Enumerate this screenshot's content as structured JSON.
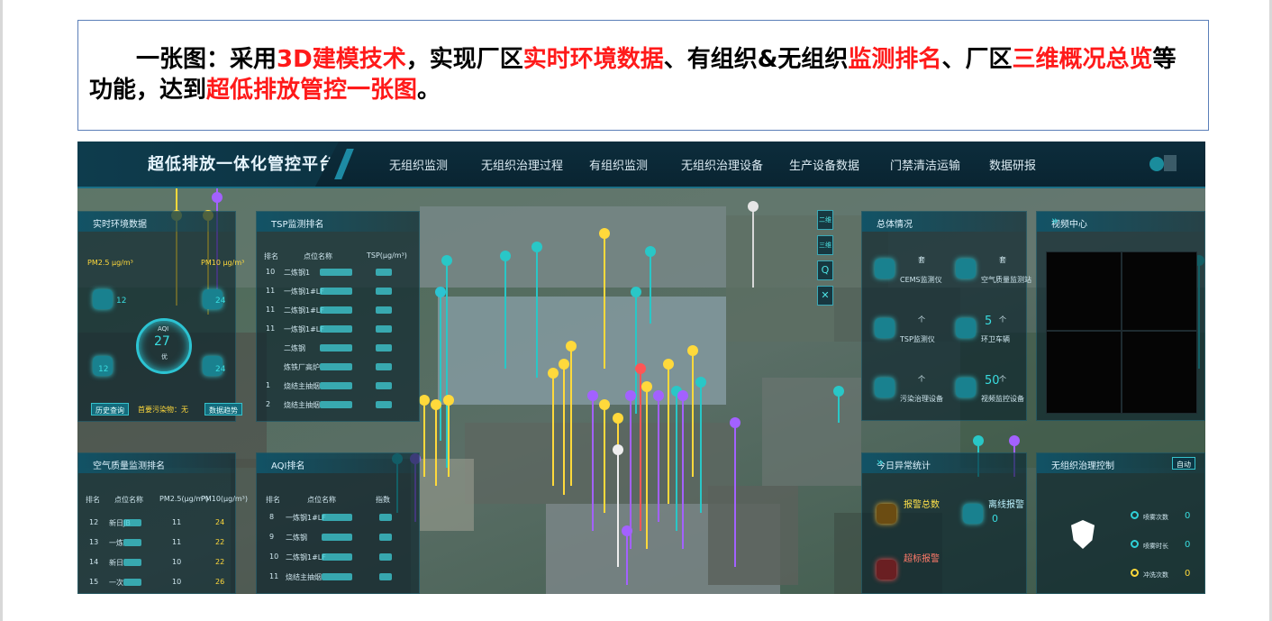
{
  "caption": {
    "segments": [
      {
        "text": "一张图：采用",
        "color": "#000000"
      },
      {
        "text": "3D建模技术",
        "color": "#ff1a1a"
      },
      {
        "text": "，实现厂区",
        "color": "#000000"
      },
      {
        "text": "实时环境数据",
        "color": "#ff1a1a"
      },
      {
        "text": "、有组织&无组织",
        "color": "#000000"
      },
      {
        "text": "监测排名",
        "color": "#ff1a1a"
      },
      {
        "text": "、厂区",
        "color": "#000000"
      },
      {
        "text": "三维概况总览",
        "color": "#ff1a1a"
      },
      {
        "text": "等功能，达到",
        "color": "#000000"
      },
      {
        "text": "超低排放管控一张图",
        "color": "#ff1a1a"
      },
      {
        "text": "。",
        "color": "#000000"
      }
    ]
  },
  "app": {
    "title": "超低排放一体化管控平台",
    "nav": [
      "无组织监测",
      "无组织治理过程",
      "有组织监测",
      "无组织治理设备",
      "生产设备数据",
      "门禁清洁运输",
      "数据研报"
    ]
  },
  "env_panel": {
    "title": "实时环境数据",
    "pm25_label": "PM2.5 μg/m³",
    "pm10_label": "PM10 μg/m³",
    "aqi_label": "AQI",
    "aqi_value": "27",
    "aqi_level": "优",
    "left_values": [
      "12",
      "12"
    ],
    "right_values": [
      "24",
      "24"
    ],
    "btn_history": "历史查询",
    "primary_pollutant": "首要污染物：无",
    "btn_data": "数据趋势"
  },
  "tsp_panel": {
    "title": "TSP监测排名",
    "headers": [
      "排名",
      "点位名称",
      "TSP(μg/m³)"
    ],
    "rows": [
      {
        "rank": "10",
        "name": "二炼钢1"
      },
      {
        "rank": "11",
        "name": "一炼钢1#LF"
      },
      {
        "rank": "11",
        "name": "二炼钢1#LF"
      },
      {
        "rank": "11",
        "name": "一炼钢1#LF"
      },
      {
        "rank": "",
        "name": "二炼钢"
      },
      {
        "rank": "",
        "name": "炼铁厂高炉"
      },
      {
        "rank": "1",
        "name": "烧结主抽烟"
      },
      {
        "rank": "2",
        "name": "烧结主抽烟"
      }
    ]
  },
  "air_panel": {
    "title": "空气质量监测排名",
    "headers": [
      "排名",
      "点位名称",
      "PM2.5(μg/m³)",
      "PM10(μg/m³)"
    ],
    "rows": [
      {
        "rank": "12",
        "name": "新日JB",
        "pm25": "11",
        "pm10": "24"
      },
      {
        "rank": "13",
        "name": "一炼",
        "pm25": "11",
        "pm10": "22"
      },
      {
        "rank": "14",
        "name": "新日",
        "pm25": "10",
        "pm10": "22"
      },
      {
        "rank": "15",
        "name": "一次",
        "pm25": "10",
        "pm10": "26"
      }
    ]
  },
  "aqi_rank_panel": {
    "title": "AQI排名",
    "headers": [
      "排名",
      "点位名称",
      "指数"
    ],
    "rows": [
      {
        "rank": "8",
        "name": "一炼钢1#LF"
      },
      {
        "rank": "9",
        "name": "二炼钢"
      },
      {
        "rank": "10",
        "name": "二炼钢1#LF"
      },
      {
        "rank": "11",
        "name": "烧结主抽烟"
      }
    ]
  },
  "overview_panel": {
    "title": "总体情况",
    "items": [
      {
        "label": "CEMS监测仪",
        "value": "",
        "unit": "套"
      },
      {
        "label": "空气质量监测站",
        "value": "",
        "unit": "套"
      },
      {
        "label": "TSP监测仪",
        "value": "",
        "unit": "个"
      },
      {
        "label": "环卫车辆",
        "value": "5",
        "unit": "个"
      },
      {
        "label": "污染治理设备",
        "value": "",
        "unit": "个"
      },
      {
        "label": "视频监控设备",
        "value": "50",
        "unit": "个"
      }
    ]
  },
  "video_panel": {
    "title": "视频中心"
  },
  "alarm_panel": {
    "title": "今日异常统计",
    "items": [
      {
        "label": "报警总数",
        "value": ""
      },
      {
        "label": "离线报警",
        "value": "0"
      },
      {
        "label": "超标报警",
        "value": ""
      }
    ]
  },
  "control_panel": {
    "title": "无组织治理控制",
    "dropdown": "自动",
    "rows": [
      {
        "label": "喷雾次数",
        "value": "0"
      },
      {
        "label": "喷雾时长",
        "value": "0"
      },
      {
        "label": "冲洗次数",
        "value": "0"
      }
    ]
  },
  "side_tools": [
    "二维",
    "三维",
    "Q",
    "✕"
  ],
  "colors": {
    "accent": "#2fd1d8",
    "caption_red": "#ff1a1a"
  }
}
